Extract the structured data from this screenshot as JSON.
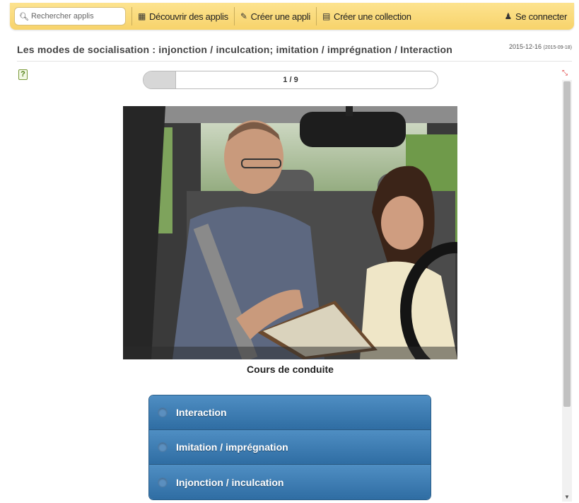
{
  "nav": {
    "search_placeholder": "Rechercher applis",
    "discover_label": "Découvrir des applis",
    "create_app_label": "Créer une appli",
    "create_collection_label": "Créer une collection",
    "login_label": "Se connecter"
  },
  "page": {
    "title": "Les modes de socialisation : injonction / inculcation; imitation / imprégnation / Interaction",
    "date": "2015-12-16",
    "date_sub": "(2015-09-18)"
  },
  "quiz": {
    "progress_text": "1 / 9",
    "progress_fraction": 0.111,
    "caption": "Cours de conduite",
    "choices": [
      "Interaction",
      "Imitation / imprégnation",
      "Injonction / inculcation"
    ]
  },
  "colors": {
    "topbar": "#f7d36b",
    "choice": "#3a78ae"
  }
}
